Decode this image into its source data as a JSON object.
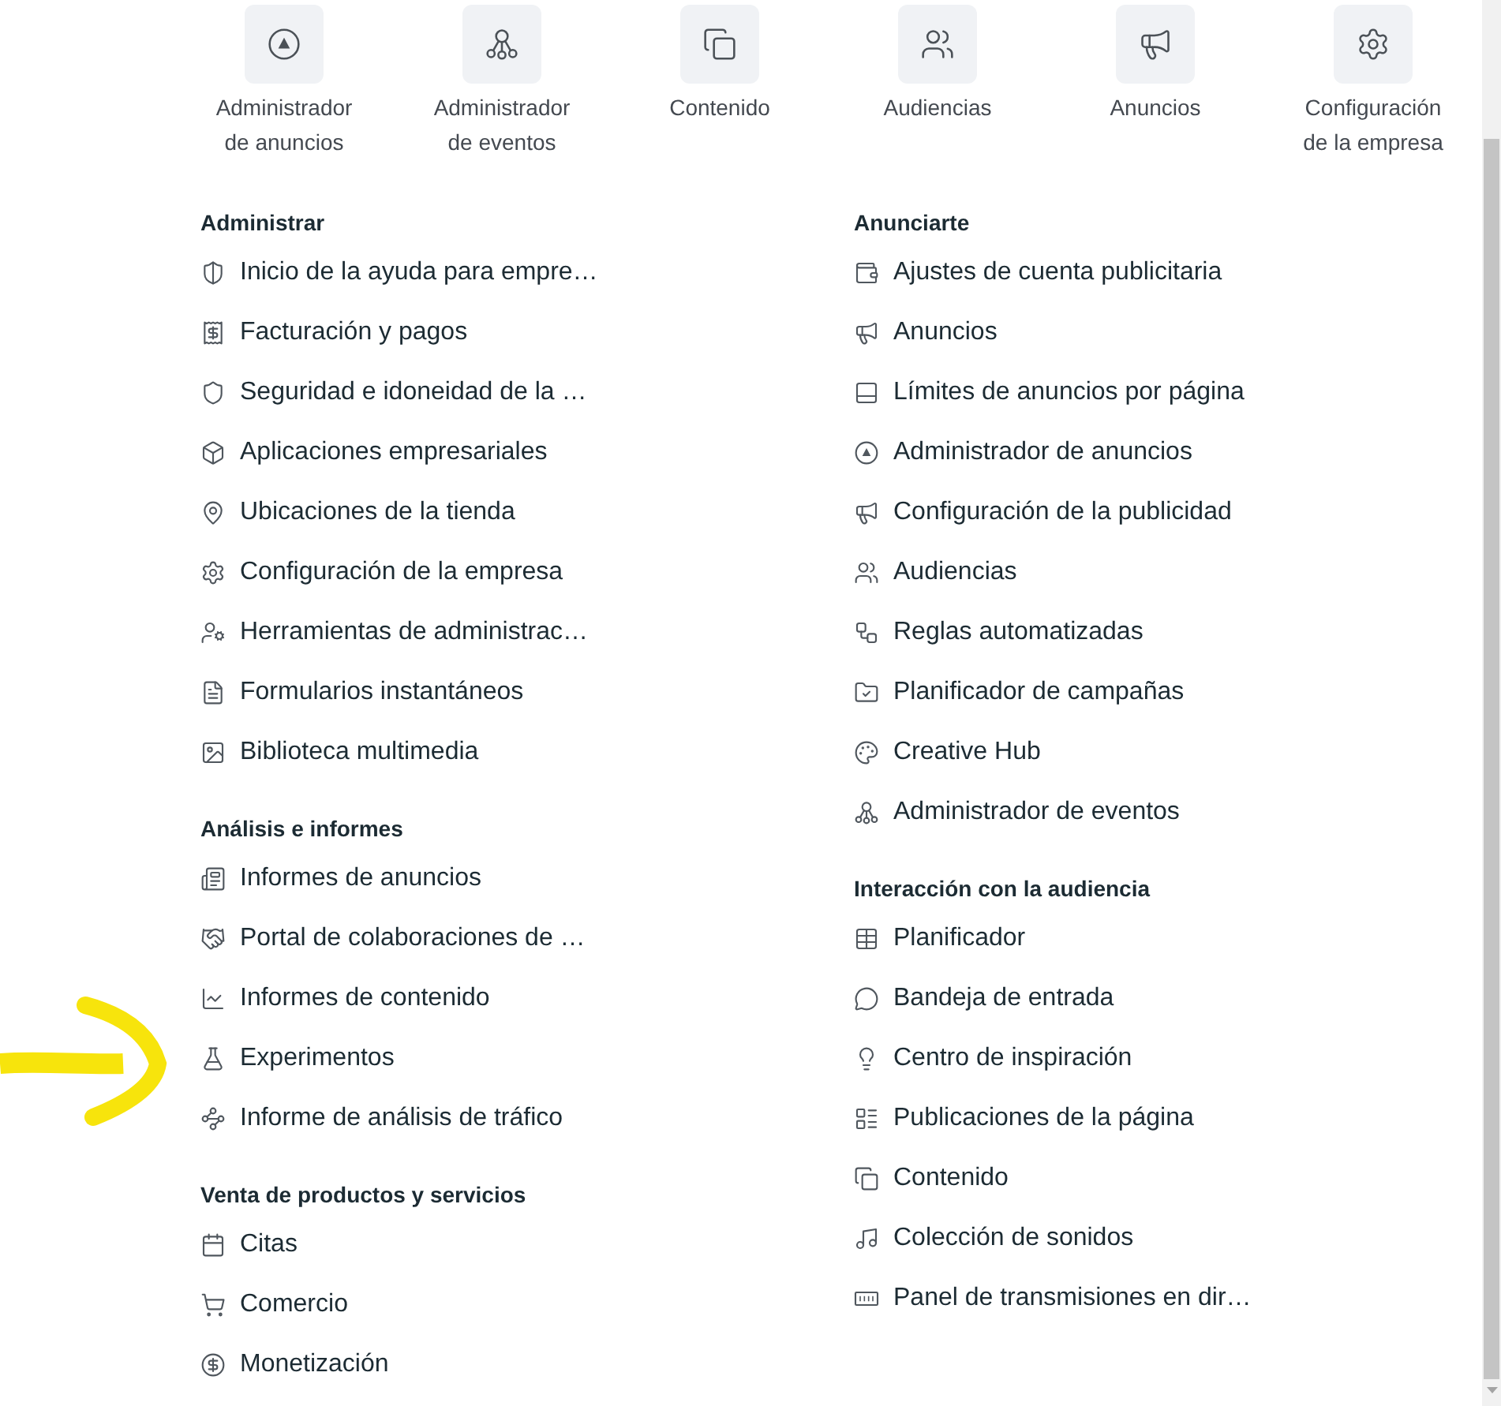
{
  "shortcuts": [
    "Administrador de anuncios",
    "Administrador de eventos",
    "Contenido",
    "Audiencias",
    "Anuncios",
    "Configuración de la empresa"
  ],
  "columns": [
    {
      "sections": [
        {
          "heading": "Administrar",
          "items": [
            "Inicio de la ayuda para empre…",
            "Facturación y pagos",
            "Seguridad e idoneidad de la …",
            "Aplicaciones empresariales",
            "Ubicaciones de la tienda",
            "Configuración de la empresa",
            "Herramientas de administrac…",
            "Formularios instantáneos",
            "Biblioteca multimedia"
          ]
        },
        {
          "heading": "Análisis e informes",
          "items": [
            "Informes de anuncios",
            "Portal de colaboraciones de …",
            "Informes de contenido",
            "Experimentos",
            "Informe de análisis de tráfico"
          ]
        },
        {
          "heading": "Venta de productos y servicios",
          "items": [
            "Citas",
            "Comercio",
            "Monetización"
          ]
        }
      ]
    },
    {
      "sections": [
        {
          "heading": "Anunciarte",
          "items": [
            "Ajustes de cuenta publicitaria",
            "Anuncios",
            "Límites de anuncios por página",
            "Administrador de anuncios",
            "Configuración de la publicidad",
            "Audiencias",
            "Reglas automatizadas",
            "Planificador de campañas",
            "Creative Hub",
            "Administrador de eventos"
          ]
        },
        {
          "heading": "Interacción con la audiencia",
          "items": [
            "Planificador",
            "Bandeja de entrada",
            "Centro de inspiración",
            "Publicaciones de la página",
            "Contenido",
            "Colección de sonidos",
            "Panel de transmisiones en dir…"
          ]
        }
      ]
    }
  ]
}
